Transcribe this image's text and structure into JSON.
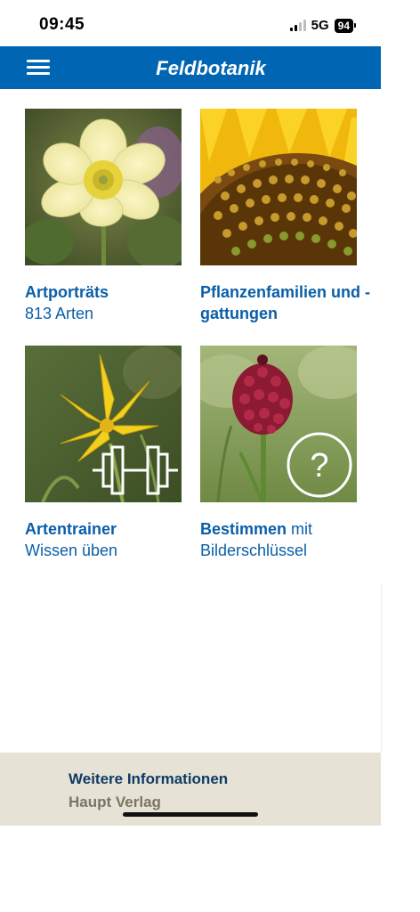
{
  "status_bar": {
    "time": "09:45",
    "network": "5G",
    "battery": "94"
  },
  "header": {
    "title": "Feldbotanik"
  },
  "tiles": [
    {
      "title": "Artporträts",
      "subtitle": "813 Arten"
    },
    {
      "title": "Pflanzenfamilien und -gattungen",
      "subtitle": ""
    },
    {
      "title": "Artentrainer",
      "subtitle": "Wissen üben"
    },
    {
      "title": "Bestimmen",
      "subtitle_inline": "mit",
      "subtitle": "Bilderschlüssel"
    }
  ],
  "footer": {
    "info": "Weitere Informationen",
    "publisher": "Haupt Verlag"
  },
  "colors": {
    "brand_blue": "#0066b3",
    "footer_bg": "#e6e3d6"
  },
  "icons": [
    "menu-icon",
    "dumbbell-icon",
    "question-circle-icon",
    "signal-icon",
    "battery-icon"
  ]
}
